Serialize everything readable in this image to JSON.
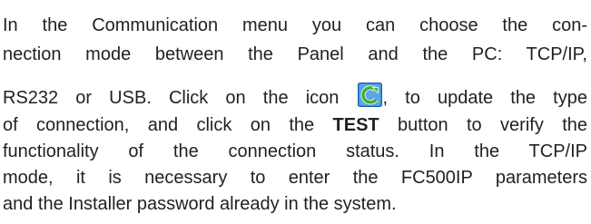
{
  "document": {
    "line1": "In the Communication menu you can choose the  con-",
    "line2": "nection mode between the Panel and the PC: TCP/IP,",
    "line3_before_icon": "RS232 or USB. Click on the icon ",
    "line3_after_icon": ", to update the type",
    "line4_before_bold": "of connection, and click on the ",
    "line4_bold": "TEST",
    "line4_after_bold": " button to verify the",
    "line5": "functionality of the connection status. In the TCP/IP",
    "line6": "mode, it is necessary to enter the  FC500IP parameters",
    "line7": "and the Installer password already in the system."
  },
  "icon": {
    "name": "refresh-icon",
    "colors": {
      "frame": "#1d5fa8",
      "fill": "#3a8fd6",
      "arrow": "#3fae2a"
    }
  }
}
